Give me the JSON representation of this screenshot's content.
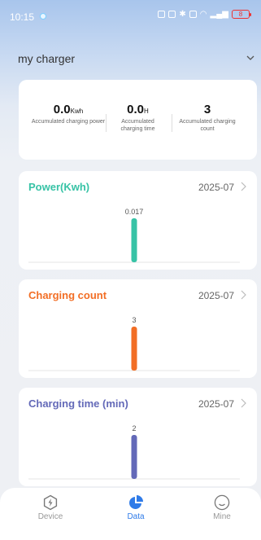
{
  "status_bar": {
    "time": "10:15",
    "battery": "8"
  },
  "header": {
    "title": "my charger"
  },
  "summary": [
    {
      "value": "0.0",
      "unit": "Kwh",
      "label": "Accumulated charging power"
    },
    {
      "value": "0.0",
      "unit": "H",
      "label": "Accumulated charging time"
    },
    {
      "value": "3",
      "unit": "",
      "label": "Accumulated charging count"
    }
  ],
  "colors": {
    "power": "#37c3a6",
    "count": "#f26e25",
    "time": "#6369b8",
    "tab_active": "#2f7be8",
    "tab_inactive": "#999999"
  },
  "chart_data": [
    {
      "type": "bar",
      "title": "Power(Kwh)",
      "period": "2025-07",
      "values": [
        0.017
      ],
      "data_labels": [
        "0.017"
      ]
    },
    {
      "type": "bar",
      "title": "Charging count",
      "period": "2025-07",
      "values": [
        3
      ],
      "data_labels": [
        "3"
      ]
    },
    {
      "type": "bar",
      "title": "Charging time (min)",
      "period": "2025-07",
      "values": [
        2
      ],
      "data_labels": [
        "2"
      ]
    }
  ],
  "tabs": [
    {
      "label": "Device",
      "icon": "lightning-bolt-icon",
      "active": false
    },
    {
      "label": "Data",
      "icon": "pie-chart-icon",
      "active": true
    },
    {
      "label": "Mine",
      "icon": "smiley-face-icon",
      "active": false
    }
  ]
}
